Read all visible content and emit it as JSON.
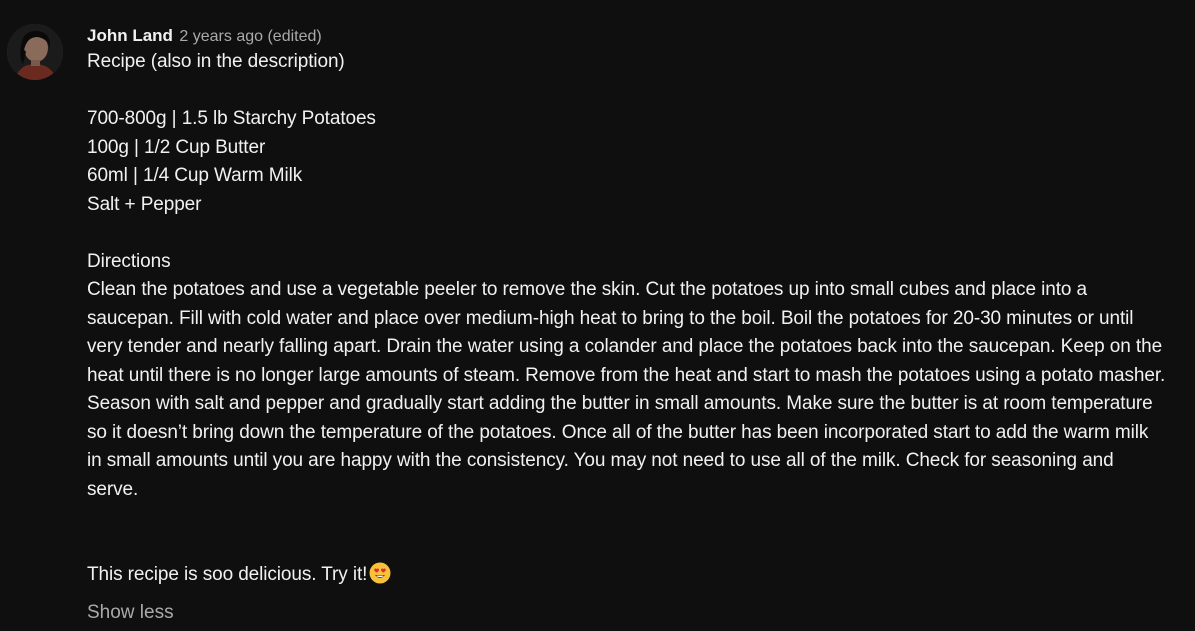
{
  "comment": {
    "author": "John Land",
    "timestamp": "2 years ago",
    "edited": "(edited)",
    "avatar_icon": "user-avatar",
    "lines": {
      "intro": "Recipe (also in the description)",
      "ingredient_1": "700-800g | 1.5 lb Starchy Potatoes",
      "ingredient_2": "100g | 1/2 Cup Butter",
      "ingredient_3": "60ml | 1/4 Cup Warm Milk",
      "ingredient_4": "Salt + Pepper",
      "directions_heading": "Directions",
      "directions_text": "Clean the potatoes and use a vegetable peeler to remove the skin. Cut the potatoes up into small cubes and place into a saucepan. Fill with cold water and place over medium-high heat to bring to the boil. Boil the potatoes for 20-30 minutes or until very tender and nearly falling apart. Drain the water using a colander and place the potatoes back into the saucepan. Keep on the heat until there is no longer large amounts of steam. Remove from the heat and start to mash the potatoes using a potato masher. Season with salt and pepper and gradually start adding the butter in small amounts. Make sure the butter is at room temperature so it doesn’t bring down the temperature of the potatoes. Once all of the butter has been incorporated start to add the warm milk in small amounts until you are happy with the consistency. You may not need to use all of the milk. Check for seasoning and serve.",
      "closing": "This recipe is soo delicious. Try it!",
      "closing_emoji": "heart-eyes-emoji"
    },
    "show_less_label": "Show less"
  },
  "colors": {
    "background": "#0f0f0f",
    "primary_text": "#f1f1f1",
    "secondary_text": "#aaaaaa"
  }
}
